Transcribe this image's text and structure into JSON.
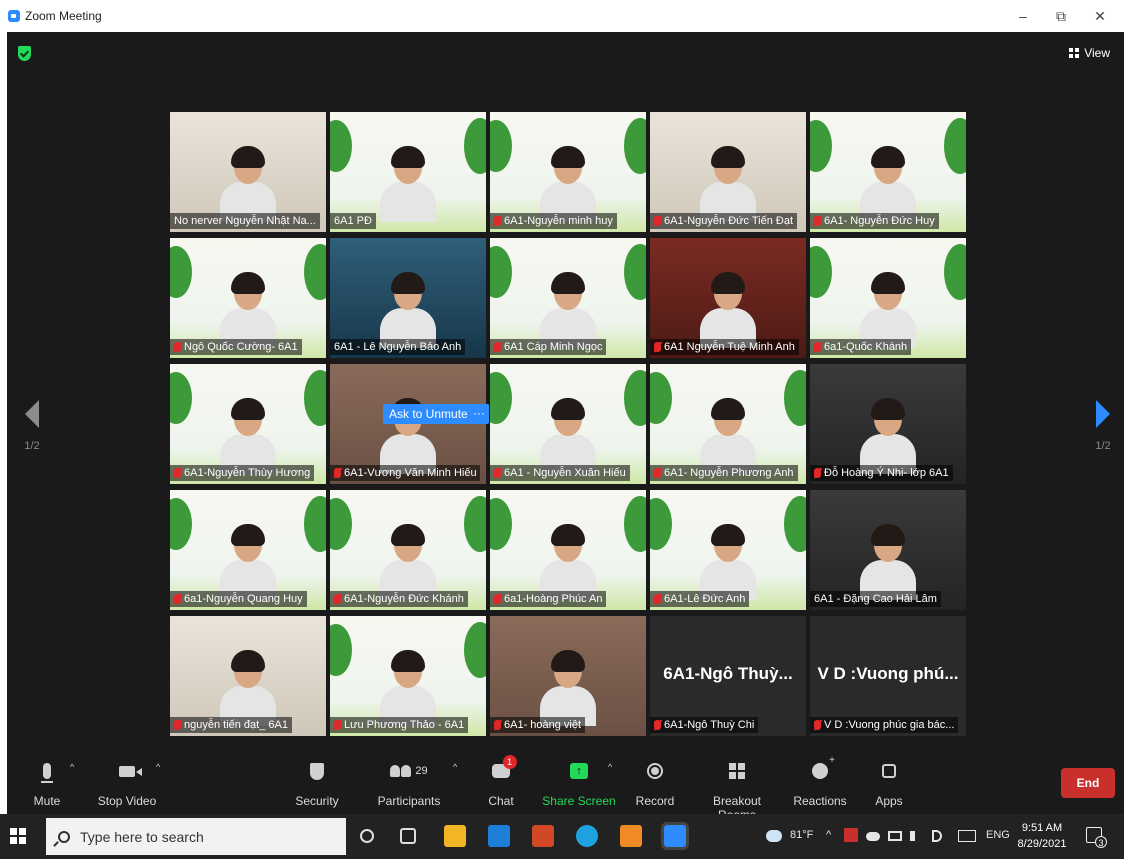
{
  "window": {
    "title": "Zoom Meeting",
    "minimize": "–",
    "restore": "⧉",
    "close": "✕"
  },
  "view": {
    "label": "View"
  },
  "pages": {
    "prev": "1/2",
    "next": "1/2"
  },
  "ask_to_unmute": "Ask to Unmute",
  "more_label": "···",
  "tiles": [
    {
      "label": "No nerver Nguyễn Nhật Na...",
      "muted": false,
      "scene": "wall"
    },
    {
      "label": "6A1 PĐ",
      "muted": false,
      "scene": "banner",
      "active": true
    },
    {
      "label": "6A1-Nguyễn minh huy",
      "muted": true,
      "scene": "banner"
    },
    {
      "label": "6A1-Nguyễn Đức Tiến Đạt",
      "muted": true,
      "scene": "wall"
    },
    {
      "label": "6A1- Nguyễn Đức Huy",
      "muted": true,
      "scene": "banner"
    },
    {
      "label": "Ngô Quốc Cường- 6A1",
      "muted": true,
      "scene": "banner"
    },
    {
      "label": "6A1 - Lê Nguyễn Bảo Anh",
      "muted": false,
      "scene": "blue"
    },
    {
      "label": "6A1 Cáp Minh Ngọc",
      "muted": true,
      "scene": "banner"
    },
    {
      "label": "6A1 Nguyễn Tuệ Minh Anh",
      "muted": true,
      "scene": "red"
    },
    {
      "label": "6a1-Quốc Khánh",
      "muted": true,
      "scene": "banner"
    },
    {
      "label": "6A1-Nguyễn Thùy Hương",
      "muted": true,
      "scene": "banner"
    },
    {
      "label": "6A1-Vương Văn Minh Hiếu",
      "muted": true,
      "scene": "room"
    },
    {
      "label": "6A1 - Nguyễn Xuân Hiếu",
      "muted": true,
      "scene": "banner"
    },
    {
      "label": "6A1- Nguyễn Phương Anh",
      "muted": true,
      "scene": "banner"
    },
    {
      "label": "Đỗ Hoàng Ý Nhi- lớp 6A1",
      "muted": true,
      "scene": "dark"
    },
    {
      "label": "6a1-Nguyễn Quang Huy",
      "muted": true,
      "scene": "banner"
    },
    {
      "label": "6A1-Nguyễn Đức Khánh",
      "muted": true,
      "scene": "banner"
    },
    {
      "label": "6a1-Hoàng Phúc An",
      "muted": true,
      "scene": "banner"
    },
    {
      "label": "6A1-Lê Đức Anh",
      "muted": true,
      "scene": "banner"
    },
    {
      "label": "6A1 - Đặng Cao Hải Lâm",
      "muted": false,
      "scene": "dark"
    },
    {
      "label": "nguyễn tiến đạt_ 6A1",
      "muted": true,
      "scene": "wall"
    },
    {
      "label": "Lưu Phương Thảo - 6A1",
      "muted": true,
      "scene": "banner"
    },
    {
      "label": "6A1- hoàng việt",
      "muted": true,
      "scene": "room"
    },
    {
      "label": "6A1-Ngô Thuỳ Chi",
      "muted": true,
      "scene": "none",
      "big_name": "6A1-Ngô  Thuỳ..."
    },
    {
      "label": "V D :Vuong phúc gia bác...",
      "muted": true,
      "scene": "none",
      "big_name": "V D :Vuong phú..."
    }
  ],
  "controls": {
    "mute": "Mute",
    "stop_video": "Stop Video",
    "security": "Security",
    "participants": "Participants",
    "participants_count": "29",
    "chat": "Chat",
    "chat_badge": "1",
    "share_screen": "Share Screen",
    "record": "Record",
    "breakout_rooms": "Breakout Rooms",
    "reactions": "Reactions",
    "apps": "Apps",
    "end": "End",
    "caret": "^",
    "share_arrow": "↑"
  },
  "taskbar": {
    "search_placeholder": "Type here to search",
    "weather": "81°F",
    "tray_chevron": "^",
    "language": "ENG",
    "time": "9:51 AM",
    "date": "8/29/2021",
    "notifications": "3"
  },
  "colors": {
    "zoom_blue": "#2d8cff",
    "end_red": "#c9302c",
    "share_green": "#23d959",
    "active_speaker": "#f4e36b"
  }
}
